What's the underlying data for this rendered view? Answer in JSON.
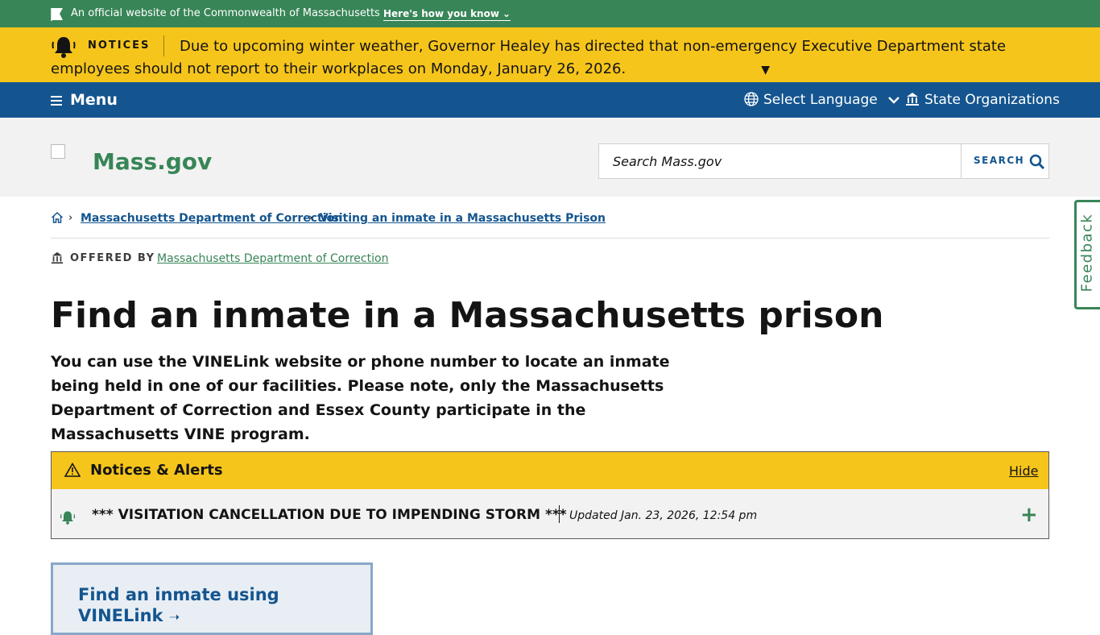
{
  "official_banner": {
    "text": "An official website of the Commonwealth of Massachusetts",
    "how_link": "Here's how you know"
  },
  "notices": {
    "label": "NOTICES",
    "message": "Due to upcoming winter weather, Governor Healey has directed that non-emergency Executive Department state employees should not report to their workplaces on Monday, January 26, 2026."
  },
  "nav": {
    "menu_label": "Menu",
    "language_label": "Select Language",
    "orgs_label": "State Organizations"
  },
  "header": {
    "site_name": "Mass.gov",
    "search_placeholder": "Search Mass.gov",
    "search_button": "SEARCH"
  },
  "feedback_label": "Feedback",
  "breadcrumbs": [
    "Massachusetts Department of Correction",
    "Visiting an inmate in a Massachusetts Prison"
  ],
  "offered_by": {
    "label": "OFFERED BY",
    "org": "Massachusetts Department of Correction"
  },
  "page": {
    "title": "Find an inmate in a Massachusetts prison",
    "lede": "You can use the VINELink website or phone number to locate an inmate being held in one of our facilities. Please note, only the Massachusetts Department of Correction and Essex County participate in the Massachusetts VINE program."
  },
  "alerts": {
    "title": "Notices & Alerts",
    "hide_label": "Hide",
    "items": [
      {
        "text": "*** VISITATION CANCELLATION DUE TO IMPENDING STORM ***",
        "updated": "Updated Jan. 23, 2026, 12:54 pm"
      }
    ]
  },
  "card": {
    "link_text": "Find an inmate using VINELink"
  },
  "colors": {
    "green": "#388557",
    "yellow": "#f6c51b",
    "blue": "#14558f"
  }
}
